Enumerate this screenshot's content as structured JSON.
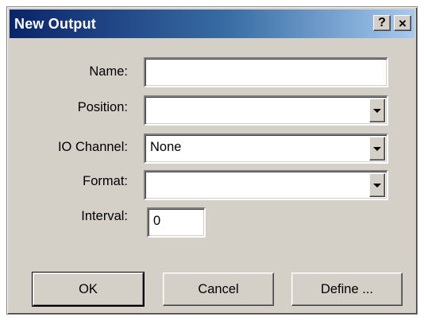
{
  "window": {
    "title": "New Output",
    "help_label": "?",
    "close_label": "×"
  },
  "form": {
    "name": {
      "label": "Name:",
      "value": ""
    },
    "position": {
      "label": "Position:",
      "value": ""
    },
    "io_channel": {
      "label": "IO Channel:",
      "value": "None"
    },
    "format": {
      "label": "Format:",
      "value": ""
    },
    "interval": {
      "label": "Interval:",
      "value": "0"
    }
  },
  "buttons": {
    "ok": "OK",
    "cancel": "Cancel",
    "define": "Define ..."
  },
  "colors": {
    "dialog_bg": "#d4d0c8",
    "title_start": "#0a246a",
    "title_end": "#a6caf0"
  },
  "icons": {
    "dropdown": "chevron-down-icon",
    "help": "help-icon",
    "close": "close-icon"
  }
}
